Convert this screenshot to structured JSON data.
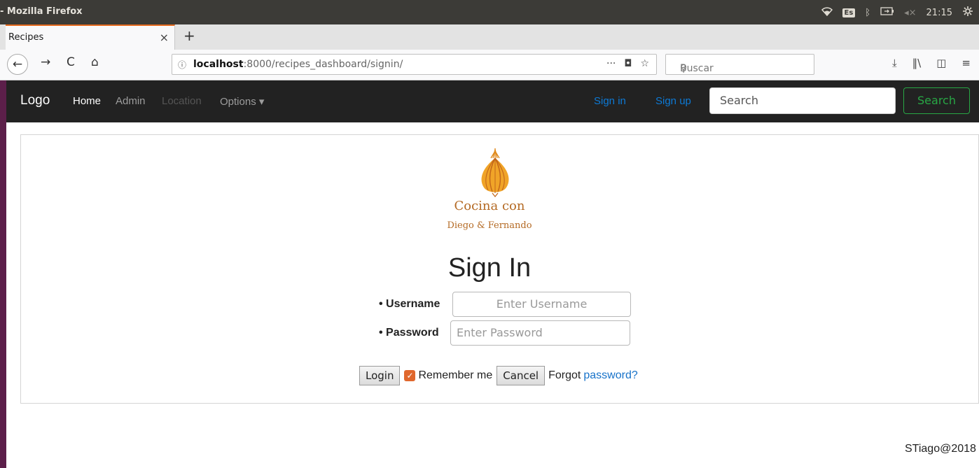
{
  "os": {
    "window_title": "- Mozilla Firefox",
    "wifi_icon": "wifi-icon",
    "keyboard_layout": "Es",
    "bluetooth_icon": "bluetooth-icon",
    "battery_icon": "battery-icon",
    "volume_icon": "volume-muted-icon",
    "clock": "21:15",
    "settings_icon": "gear-icon"
  },
  "browser": {
    "tab_title": "Recipes",
    "tab_close": "×",
    "new_tab": "+",
    "url_host": "localhost",
    "url_path": ":8000/recipes_dashboard/signin/",
    "search_placeholder": "Buscar"
  },
  "site": {
    "brand": "Logo",
    "nav": {
      "home": "Home",
      "admin": "Admin",
      "location": "Location",
      "options": "Options ▾",
      "signin": "Sign in",
      "signup": "Sign up"
    },
    "search_placeholder": "Search",
    "search_button": "Search",
    "colors": {
      "navbar_bg": "#222222",
      "link_blue": "#0d7ad6",
      "search_green": "#28a745",
      "logo_orange": "#b46a24"
    }
  },
  "logo": {
    "line1": "Cocina con",
    "line2": "Diego & Fernando"
  },
  "signin": {
    "title": "Sign In",
    "username_label": "Username",
    "username_placeholder": "Enter Username",
    "password_label": "Password",
    "password_placeholder": "Enter Password",
    "login_button": "Login",
    "remember_me": "Remember me",
    "remember_checked": true,
    "cancel_button": "Cancel",
    "forgot_text": "Forgot",
    "forgot_link": "password?"
  },
  "footer": {
    "text": "STiago@2018"
  }
}
